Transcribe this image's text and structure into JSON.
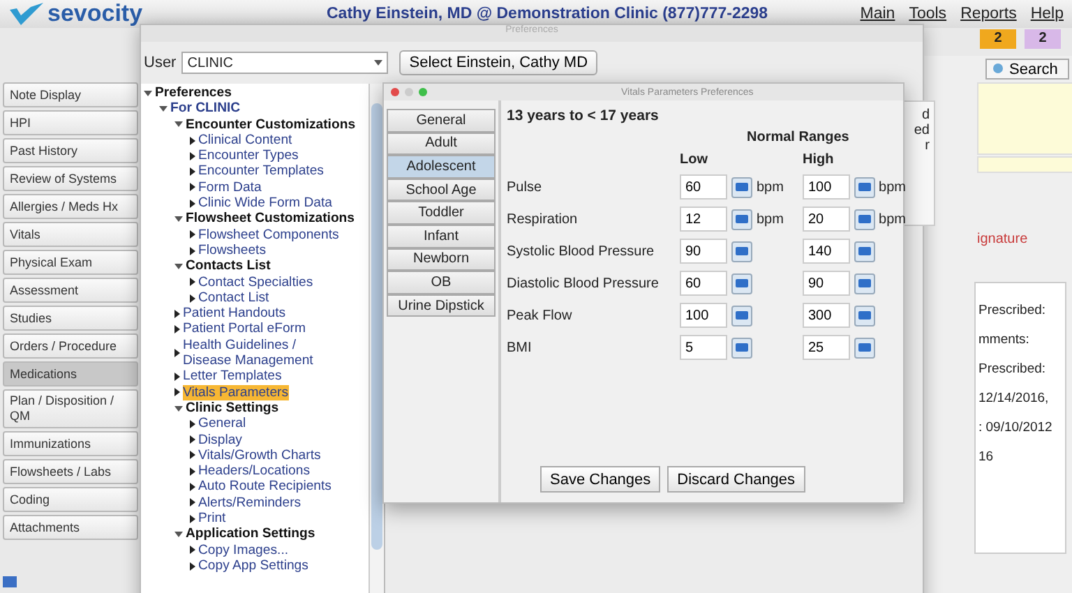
{
  "app": {
    "logo": "sevocity",
    "title": "Cathy Einstein, MD @ Demonstration Clinic (877)777-2298",
    "menu": [
      "Main",
      "Tools",
      "Reports",
      "Help"
    ],
    "badges": [
      {
        "count": "2",
        "color": "#f0a81e"
      },
      {
        "count": "2",
        "color": "#d8b8e8"
      }
    ],
    "search_button": "Search"
  },
  "sidebar": {
    "items": [
      {
        "label": "Note Display",
        "selected": false
      },
      {
        "label": "HPI",
        "selected": false
      },
      {
        "label": "Past History",
        "selected": false
      },
      {
        "label": "Review of Systems",
        "selected": false
      },
      {
        "label": "Allergies / Meds Hx",
        "selected": false
      },
      {
        "label": "Vitals",
        "selected": false
      },
      {
        "label": "Physical Exam",
        "selected": false
      },
      {
        "label": "Assessment",
        "selected": false
      },
      {
        "label": "Studies",
        "selected": false
      },
      {
        "label": "Orders / Procedure",
        "selected": false
      },
      {
        "label": "Medications",
        "selected": true
      },
      {
        "label": "Plan / Disposition / QM",
        "selected": false
      },
      {
        "label": "Immunizations",
        "selected": false
      },
      {
        "label": "Flowsheets / Labs",
        "selected": false
      },
      {
        "label": "Coding",
        "selected": false
      },
      {
        "label": "Attachments",
        "selected": false
      }
    ]
  },
  "background_fragments": {
    "box_text": [
      "d",
      "ed",
      "r"
    ],
    "signature": "ignature",
    "notes": [
      "Prescribed:",
      "mments:",
      "Prescribed:",
      "12/14/2016,",
      ": 09/10/2012",
      "16"
    ]
  },
  "preferences": {
    "title": "Preferences",
    "user_label": "User",
    "user_value": "CLINIC",
    "select_button": "Select Einstein, Cathy MD",
    "tree": [
      {
        "label": "Preferences",
        "expanded": true,
        "selected": false,
        "children": [
          {
            "label": "For CLINIC",
            "expanded": true,
            "selected": false,
            "children": [
              {
                "label": "Encounter Customizations",
                "expanded": true,
                "selected": false,
                "children": [
                  {
                    "label": "Clinical Content",
                    "selected": false
                  },
                  {
                    "label": "Encounter Types",
                    "selected": false
                  },
                  {
                    "label": "Encounter Templates",
                    "selected": false
                  },
                  {
                    "label": "Form Data",
                    "selected": false
                  },
                  {
                    "label": "Clinic Wide Form Data",
                    "selected": false
                  }
                ]
              },
              {
                "label": "Flowsheet Customizations",
                "expanded": true,
                "selected": false,
                "children": [
                  {
                    "label": "Flowsheet Components",
                    "selected": false
                  },
                  {
                    "label": "Flowsheets",
                    "selected": false
                  }
                ]
              },
              {
                "label": "Contacts List",
                "expanded": true,
                "selected": false,
                "children": [
                  {
                    "label": "Contact Specialties",
                    "selected": false
                  },
                  {
                    "label": "Contact List",
                    "selected": false
                  }
                ]
              },
              {
                "label": "Patient Handouts",
                "selected": false
              },
              {
                "label": "Patient Portal eForm",
                "selected": false
              },
              {
                "label": "Health Guidelines / Disease Management",
                "selected": false
              },
              {
                "label": "Letter Templates",
                "selected": false
              },
              {
                "label": "Vitals Parameters",
                "selected": true
              },
              {
                "label": "Clinic Settings",
                "expanded": true,
                "selected": false,
                "children": [
                  {
                    "label": "General",
                    "selected": false
                  },
                  {
                    "label": "Display",
                    "selected": false
                  },
                  {
                    "label": "Vitals/Growth Charts",
                    "selected": false
                  },
                  {
                    "label": "Headers/Locations",
                    "selected": false
                  },
                  {
                    "label": "Auto Route Recipients",
                    "selected": false
                  },
                  {
                    "label": "Alerts/Reminders",
                    "selected": false
                  },
                  {
                    "label": "Print",
                    "selected": false
                  }
                ]
              },
              {
                "label": "Application Settings",
                "expanded": true,
                "selected": false,
                "children": [
                  {
                    "label": "Copy Images...",
                    "selected": false
                  },
                  {
                    "label": "Copy App Settings",
                    "selected": false
                  }
                ]
              }
            ]
          }
        ]
      }
    ]
  },
  "vitals_dialog": {
    "title": "Vitals Parameters Preferences",
    "tabs": [
      {
        "label": "General",
        "selected": false
      },
      {
        "label": "Adult",
        "selected": false
      },
      {
        "label": "Adolescent",
        "selected": true
      },
      {
        "label": "School Age",
        "selected": false
      },
      {
        "label": "Toddler",
        "selected": false
      },
      {
        "label": "Infant",
        "selected": false
      },
      {
        "label": "Newborn",
        "selected": false
      },
      {
        "label": "OB",
        "selected": false
      },
      {
        "label": "Urine Dipstick",
        "selected": false
      }
    ],
    "age_range": "13 years to < 17 years",
    "ranges_heading": "Normal Ranges",
    "low_heading": "Low",
    "high_heading": "High",
    "rows": [
      {
        "name": "Pulse",
        "low": "60",
        "low_unit": "bpm",
        "high": "100",
        "high_unit": "bpm"
      },
      {
        "name": "Respiration",
        "low": "12",
        "low_unit": "bpm",
        "high": "20",
        "high_unit": "bpm"
      },
      {
        "name": "Systolic Blood Pressure",
        "low": "90",
        "high": "140"
      },
      {
        "name": "Diastolic Blood Pressure",
        "low": "60",
        "high": "90"
      },
      {
        "name": "Peak Flow",
        "low": "100",
        "high": "300"
      },
      {
        "name": "BMI",
        "low": "5",
        "high": "25"
      }
    ],
    "buttons": [
      "Save Changes",
      "Discard Changes"
    ]
  }
}
